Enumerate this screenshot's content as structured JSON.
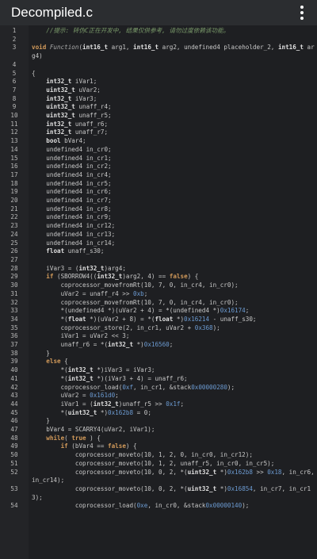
{
  "app": {
    "title": "Decompiled.c",
    "menu_icon": "more-vert-icon"
  },
  "code": {
    "lines": [
      {
        "n": "1",
        "tokens": [
          {
            "t": "    //提示: 转伪C正在开发中, 结果仅供参考, 请勿过度依赖该功能。",
            "c": "cm"
          }
        ]
      },
      {
        "n": "2",
        "tokens": []
      },
      {
        "n": "3",
        "tokens": [
          {
            "t": "void ",
            "c": "kw"
          },
          {
            "t": "Function",
            "c": "fn"
          },
          {
            "t": "("
          },
          {
            "t": "int16_t",
            "c": "ty"
          },
          {
            "t": " arg1, "
          },
          {
            "t": "int16_t",
            "c": "ty"
          },
          {
            "t": " arg2, undefined4 placeholder_2, "
          },
          {
            "t": "int16_t",
            "c": "ty"
          },
          {
            "t": " arg4)"
          }
        ]
      },
      {
        "n": "4",
        "tokens": []
      },
      {
        "n": "5",
        "tokens": [
          {
            "t": "{"
          }
        ]
      },
      {
        "n": "6",
        "tokens": [
          {
            "t": "    "
          },
          {
            "t": "int32_t",
            "c": "ty"
          },
          {
            "t": " iVar1;"
          }
        ]
      },
      {
        "n": "7",
        "tokens": [
          {
            "t": "    "
          },
          {
            "t": "uint32_t",
            "c": "ty"
          },
          {
            "t": " uVar2;"
          }
        ]
      },
      {
        "n": "8",
        "tokens": [
          {
            "t": "    "
          },
          {
            "t": "int32_t",
            "c": "ty"
          },
          {
            "t": " iVar3;"
          }
        ]
      },
      {
        "n": "9",
        "tokens": [
          {
            "t": "    "
          },
          {
            "t": "uint32_t",
            "c": "ty"
          },
          {
            "t": " unaff_r4;"
          }
        ]
      },
      {
        "n": "10",
        "tokens": [
          {
            "t": "    "
          },
          {
            "t": "uint32_t",
            "c": "ty"
          },
          {
            "t": " unaff_r5;"
          }
        ]
      },
      {
        "n": "11",
        "tokens": [
          {
            "t": "    "
          },
          {
            "t": "int32_t",
            "c": "ty"
          },
          {
            "t": " unaff_r6;"
          }
        ]
      },
      {
        "n": "12",
        "tokens": [
          {
            "t": "    "
          },
          {
            "t": "int32_t",
            "c": "ty"
          },
          {
            "t": " unaff_r7;"
          }
        ]
      },
      {
        "n": "13",
        "tokens": [
          {
            "t": "    "
          },
          {
            "t": "bool",
            "c": "ty"
          },
          {
            "t": " bVar4;"
          }
        ]
      },
      {
        "n": "14",
        "tokens": [
          {
            "t": "    undefined4 in_cr0;"
          }
        ]
      },
      {
        "n": "15",
        "tokens": [
          {
            "t": "    undefined4 in_cr1;"
          }
        ]
      },
      {
        "n": "16",
        "tokens": [
          {
            "t": "    undefined4 in_cr2;"
          }
        ]
      },
      {
        "n": "17",
        "tokens": [
          {
            "t": "    undefined4 in_cr4;"
          }
        ]
      },
      {
        "n": "18",
        "tokens": [
          {
            "t": "    undefined4 in_cr5;"
          }
        ]
      },
      {
        "n": "19",
        "tokens": [
          {
            "t": "    undefined4 in_cr6;"
          }
        ]
      },
      {
        "n": "20",
        "tokens": [
          {
            "t": "    undefined4 in_cr7;"
          }
        ]
      },
      {
        "n": "21",
        "tokens": [
          {
            "t": "    undefined4 in_cr8;"
          }
        ]
      },
      {
        "n": "22",
        "tokens": [
          {
            "t": "    undefined4 in_cr9;"
          }
        ]
      },
      {
        "n": "23",
        "tokens": [
          {
            "t": "    undefined4 in_cr12;"
          }
        ]
      },
      {
        "n": "24",
        "tokens": [
          {
            "t": "    undefined4 in_cr13;"
          }
        ]
      },
      {
        "n": "25",
        "tokens": [
          {
            "t": "    undefined4 in_cr14;"
          }
        ]
      },
      {
        "n": "26",
        "tokens": [
          {
            "t": "    "
          },
          {
            "t": "float",
            "c": "ty"
          },
          {
            "t": " unaff_s30;"
          }
        ]
      },
      {
        "n": "27",
        "tokens": []
      },
      {
        "n": "28",
        "tokens": [
          {
            "t": "    iVar3 = ("
          },
          {
            "t": "int32_t",
            "c": "ty"
          },
          {
            "t": ")arg4;"
          }
        ]
      },
      {
        "n": "29",
        "tokens": [
          {
            "t": "    "
          },
          {
            "t": "if",
            "c": "kw"
          },
          {
            "t": " (SBORROW4(("
          },
          {
            "t": "int32_t",
            "c": "ty"
          },
          {
            "t": ")arg2, 4) == "
          },
          {
            "t": "false",
            "c": "kw"
          },
          {
            "t": ") {"
          }
        ]
      },
      {
        "n": "30",
        "tokens": [
          {
            "t": "        coprocessor_movefromRt(10, 7, 0, in_cr4, in_cr0);"
          }
        ]
      },
      {
        "n": "31",
        "tokens": [
          {
            "t": "        uVar2 = unaff_r4 >> "
          },
          {
            "t": "0xb",
            "c": "num"
          },
          {
            "t": ";"
          }
        ]
      },
      {
        "n": "32",
        "tokens": [
          {
            "t": "        coprocessor_movefromRt(10, 7, 0, in_cr4, in_cr0);"
          }
        ]
      },
      {
        "n": "33",
        "tokens": [
          {
            "t": "        *(undefined4 *)(uVar2 + 4) = *(undefined4 *)"
          },
          {
            "t": "0x16174",
            "c": "num"
          },
          {
            "t": ";"
          }
        ]
      },
      {
        "n": "34",
        "tokens": [
          {
            "t": "        *("
          },
          {
            "t": "float",
            "c": "ty"
          },
          {
            "t": " *)(uVar2 + 8) = *("
          },
          {
            "t": "float",
            "c": "ty"
          },
          {
            "t": " *)"
          },
          {
            "t": "0x16214",
            "c": "num"
          },
          {
            "t": " - unaff_s30;"
          }
        ]
      },
      {
        "n": "35",
        "tokens": [
          {
            "t": "        coprocessor_store(2, in_cr1, uVar2 + "
          },
          {
            "t": "0x368",
            "c": "num"
          },
          {
            "t": ");"
          }
        ]
      },
      {
        "n": "36",
        "tokens": [
          {
            "t": "        iVar1 = uVar2 << 3;"
          }
        ]
      },
      {
        "n": "37",
        "tokens": [
          {
            "t": "        unaff_r6 = *("
          },
          {
            "t": "int32_t",
            "c": "ty"
          },
          {
            "t": " *)"
          },
          {
            "t": "0x16560",
            "c": "num"
          },
          {
            "t": ";"
          }
        ]
      },
      {
        "n": "38",
        "tokens": [
          {
            "t": "    }"
          }
        ]
      },
      {
        "n": "39",
        "tokens": [
          {
            "t": "    "
          },
          {
            "t": "else",
            "c": "kw"
          },
          {
            "t": " {"
          }
        ]
      },
      {
        "n": "40",
        "tokens": [
          {
            "t": "        *("
          },
          {
            "t": "int32_t",
            "c": "ty"
          },
          {
            "t": " *)iVar3 = iVar3;"
          }
        ]
      },
      {
        "n": "41",
        "tokens": [
          {
            "t": "        *("
          },
          {
            "t": "int32_t",
            "c": "ty"
          },
          {
            "t": " *)(iVar3 + 4) = unaff_r6;"
          }
        ]
      },
      {
        "n": "42",
        "tokens": [
          {
            "t": "        coprocessor_load("
          },
          {
            "t": "0xf",
            "c": "num"
          },
          {
            "t": ", in_cr1, &stack"
          },
          {
            "t": "0x00000280",
            "c": "num"
          },
          {
            "t": ");"
          }
        ]
      },
      {
        "n": "43",
        "tokens": [
          {
            "t": "        uVar2 = "
          },
          {
            "t": "0x161d0",
            "c": "num"
          },
          {
            "t": ";"
          }
        ]
      },
      {
        "n": "44",
        "tokens": [
          {
            "t": "        iVar1 = ("
          },
          {
            "t": "int32_t",
            "c": "ty"
          },
          {
            "t": ")unaff_r5 >> "
          },
          {
            "t": "0x1f",
            "c": "num"
          },
          {
            "t": ";"
          }
        ]
      },
      {
        "n": "45",
        "tokens": [
          {
            "t": "        *("
          },
          {
            "t": "uint32_t",
            "c": "ty"
          },
          {
            "t": " *)"
          },
          {
            "t": "0x162b8",
            "c": "num"
          },
          {
            "t": " = 0;"
          }
        ]
      },
      {
        "n": "46",
        "tokens": [
          {
            "t": "    }"
          }
        ]
      },
      {
        "n": "47",
        "tokens": [
          {
            "t": "    bVar4 = SCARRY4(uVar2, iVar1);"
          }
        ]
      },
      {
        "n": "48",
        "tokens": [
          {
            "t": "    "
          },
          {
            "t": "while",
            "c": "kw"
          },
          {
            "t": "( "
          },
          {
            "t": "true",
            "c": "kw"
          },
          {
            "t": " ) {"
          }
        ]
      },
      {
        "n": "49",
        "tokens": [
          {
            "t": "        "
          },
          {
            "t": "if",
            "c": "kw"
          },
          {
            "t": " (bVar4 == "
          },
          {
            "t": "false",
            "c": "kw"
          },
          {
            "t": ") {"
          }
        ]
      },
      {
        "n": "50",
        "tokens": [
          {
            "t": "            coprocessor_moveto(10, 1, 2, 0, in_cr0, in_cr12);"
          }
        ]
      },
      {
        "n": "51",
        "tokens": [
          {
            "t": "            coprocessor_moveto(10, 1, 2, unaff_r5, in_cr0, in_cr5);"
          }
        ]
      },
      {
        "n": "52",
        "tokens": [
          {
            "t": "            coprocessor_moveto(10, 0, 2, *("
          },
          {
            "t": "uint32_t",
            "c": "ty"
          },
          {
            "t": " *)"
          },
          {
            "t": "0x162b8",
            "c": "num"
          },
          {
            "t": " >> "
          },
          {
            "t": "0x18",
            "c": "num"
          },
          {
            "t": ", in_cr6, in_cr14);"
          }
        ]
      },
      {
        "n": "53",
        "tokens": [
          {
            "t": "            coprocessor_moveto(10, 0, 2, *("
          },
          {
            "t": "uint32_t",
            "c": "ty"
          },
          {
            "t": " *)"
          },
          {
            "t": "0x16854",
            "c": "num"
          },
          {
            "t": ", in_cr7, in_cr13);"
          }
        ]
      },
      {
        "n": "54",
        "tokens": [
          {
            "t": "            coprocessor_load("
          },
          {
            "t": "0xe",
            "c": "num"
          },
          {
            "t": ", in_cr0, &stack"
          },
          {
            "t": "0x00000140",
            "c": "num"
          },
          {
            "t": ");"
          }
        ]
      }
    ]
  },
  "colors": {
    "background": "#1e1f22",
    "gutter": "#232427",
    "keyword": "#d29a5a",
    "number": "#6c9bd2",
    "comment": "#7a9a6a"
  }
}
